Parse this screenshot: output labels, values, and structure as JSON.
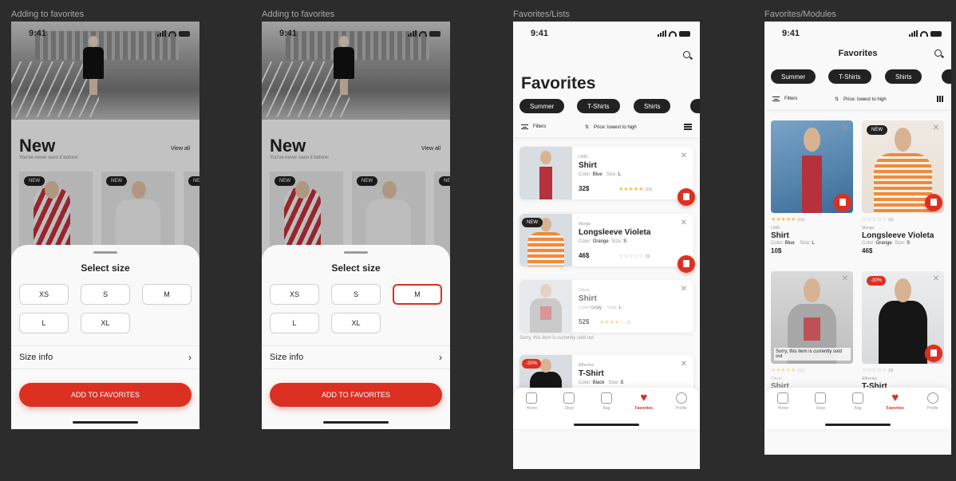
{
  "frames": [
    {
      "label": "Adding to favorites"
    },
    {
      "label": "Adding to favorites"
    },
    {
      "label": "Favorites/Lists"
    },
    {
      "label": "Favorites/Modules"
    }
  ],
  "status": {
    "time": "9:41"
  },
  "new_section": {
    "title": "New",
    "subtitle": "You've never seen it before!",
    "view_all": "View all",
    "badge": "NEW"
  },
  "size_sheet": {
    "title": "Select size",
    "sizes": [
      "XS",
      "S",
      "M",
      "L",
      "XL"
    ],
    "selected_in_frame2": "M",
    "size_info": "Size info",
    "cta": "ADD TO FAVORITES"
  },
  "favorites": {
    "title": "Favorites",
    "chips": [
      "Summer",
      "T-Shirts",
      "Shirts"
    ],
    "filters": "Filters",
    "sort": "Price: lowest to high",
    "sold_out": "Sorry, this item is currently sold out",
    "items": [
      {
        "brand": "LIME",
        "name": "Shirt",
        "color_label": "Color:",
        "color": "Blue",
        "size_label": "Size:",
        "size": "L",
        "price": "32$",
        "price_module": "10$",
        "rating": "★★★★★",
        "reviews": "(10)"
      },
      {
        "brand": "Mango",
        "name": "Longsleeve Violeta",
        "color_label": "Color:",
        "color": "Orange",
        "size_label": "Size:",
        "size": "S",
        "price": "46$",
        "rating": "☆☆☆☆☆",
        "reviews": "(0)",
        "badge": "NEW"
      },
      {
        "brand": "Olivier",
        "name": "Shirt",
        "color_label": "Color:",
        "color": "Gray",
        "size_label": "Size:",
        "size": "L",
        "price": "52$",
        "rating": "★★★★☆",
        "reviews": "(3)"
      },
      {
        "brand": "&Berries",
        "name": "T-Shirt",
        "color_label": "Color:",
        "color": "Black",
        "size_label": "Size:",
        "size": "S",
        "rating": "☆☆☆☆☆",
        "reviews": "(0)",
        "badge": "-30%"
      }
    ],
    "module_hidden_brand": "Olivier",
    "module_hidden_name": "Shirt",
    "module_sold_out": "Sorry, this item is currently sold out"
  },
  "tabbar": {
    "home": "Home",
    "shop": "Shop",
    "bag": "Bag",
    "favorites": "Favorites",
    "profile": "Profile"
  },
  "colors": {
    "accent": "#DB3022",
    "dark": "#222222",
    "star": "#FFBA49"
  }
}
